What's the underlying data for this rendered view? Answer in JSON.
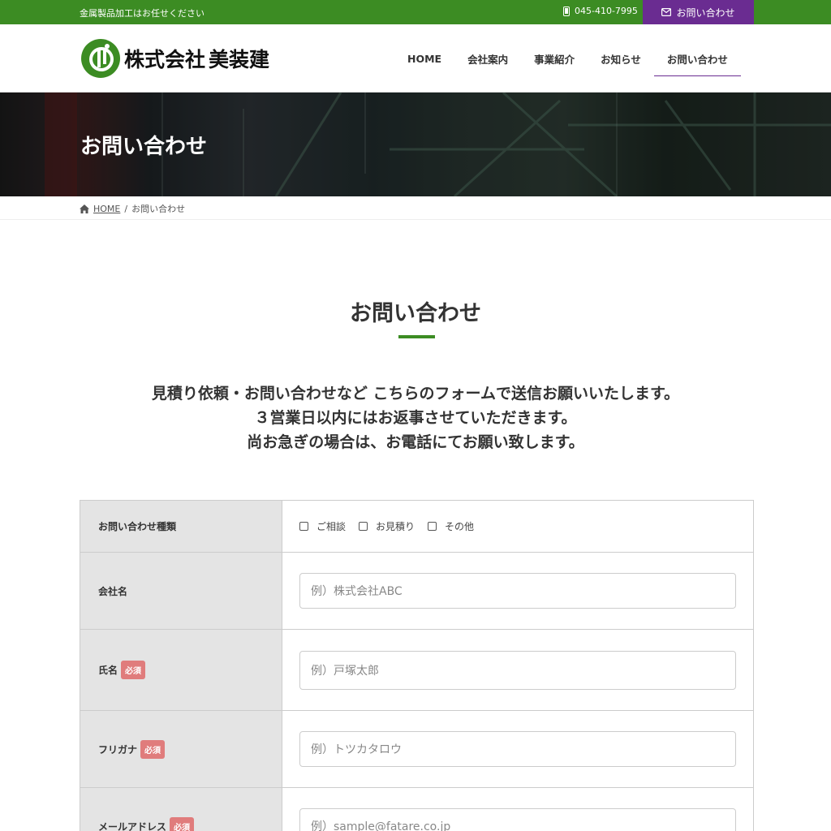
{
  "topbar": {
    "tagline": "金属製品加工はお任せください",
    "phone": "045-410-7995",
    "contact_label": "お問い合わせ"
  },
  "header": {
    "logo_text_1": "株式会社",
    "logo_text_2": "美装建",
    "nav": [
      "HOME",
      "会社案内",
      "事業紹介",
      "お知らせ",
      "お問い合わせ"
    ]
  },
  "hero": {
    "title": "お問い合わせ"
  },
  "breadcrumb": {
    "home": "HOME",
    "separator": "/",
    "current": "お問い合わせ"
  },
  "section": {
    "title": "お問い合わせ",
    "intro": [
      "見積り依頼・お問い合わせなど こちらのフォームで送信お願いいたします。",
      "３営業日以内にはお返事させていただきます。",
      "尚お急ぎの場合は、お電話にてお願い致します。"
    ]
  },
  "form": {
    "inquiry_type_label": "お問い合わせ種類",
    "inquiry_options": [
      "ご相談",
      "お見積り",
      "その他"
    ],
    "company_label": "会社名",
    "company_placeholder": "例）株式会社ABC",
    "name_label": "氏名",
    "name_placeholder": "例）戸塚太郎",
    "kana_label": "フリガナ",
    "kana_placeholder": "例）トツカタロウ",
    "email_label": "メールアドレス",
    "email_placeholder": "例）sample@fatare.co.jp",
    "required_badge": "必須"
  },
  "colors": {
    "green": "#3c8c23",
    "purple": "#6a2c91",
    "required": "#e07c7c"
  }
}
